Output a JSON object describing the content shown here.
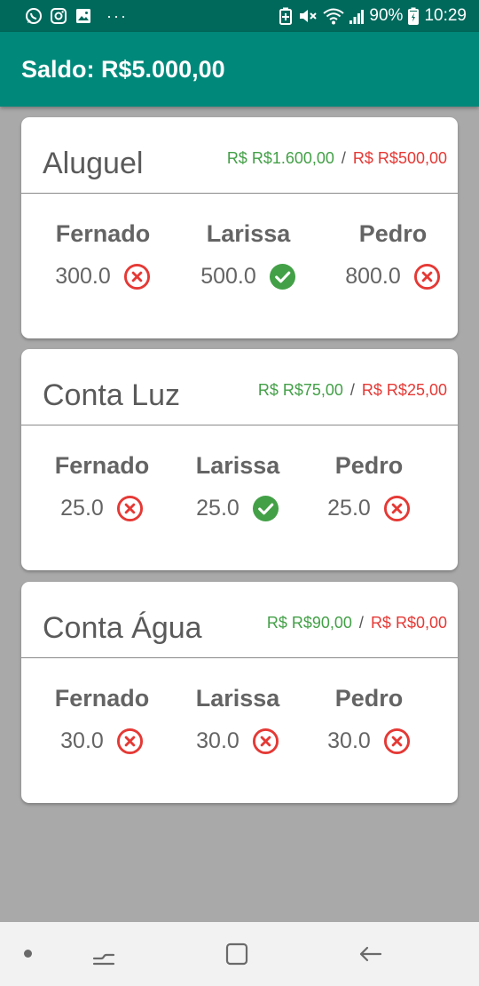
{
  "status_bar": {
    "battery": "90%",
    "time": "10:29",
    "overflow": "···",
    "icons": [
      "whatsapp-icon",
      "instagram-icon",
      "image-icon",
      "battery-saver-icon",
      "mute-icon",
      "wifi-icon",
      "signal-icon",
      "battery-icon"
    ]
  },
  "app_bar": {
    "title": "Saldo: R$5.000,00"
  },
  "colors": {
    "status_bar": "#00695c",
    "app_bar": "#00897b",
    "paid_green": "#43a047",
    "pending_red": "#e53935",
    "background": "#a9a9a9"
  },
  "bills": [
    {
      "title": "Aluguel",
      "total": "R$ R$1.600,00",
      "separator": "/",
      "remaining": "R$ R$500,00",
      "people": [
        {
          "name": "Fernado",
          "value": "300.0",
          "status": "pending"
        },
        {
          "name": "Larissa",
          "value": "500.0",
          "status": "paid"
        },
        {
          "name": "Pedro",
          "value": "800.0",
          "status": "pending"
        }
      ]
    },
    {
      "title": "Conta Luz",
      "total": "R$ R$75,00",
      "separator": "/",
      "remaining": "R$ R$25,00",
      "people": [
        {
          "name": "Fernado",
          "value": "25.0",
          "status": "pending"
        },
        {
          "name": "Larissa",
          "value": "25.0",
          "status": "paid"
        },
        {
          "name": "Pedro",
          "value": "25.0",
          "status": "pending"
        }
      ]
    },
    {
      "title": "Conta Água",
      "total": "R$ R$90,00",
      "separator": "/",
      "remaining": "R$ R$0,00",
      "people": [
        {
          "name": "Fernado",
          "value": "30.0",
          "status": "pending"
        },
        {
          "name": "Larissa",
          "value": "30.0",
          "status": "pending"
        },
        {
          "name": "Pedro",
          "value": "30.0",
          "status": "pending"
        }
      ]
    }
  ],
  "nav_bar": {
    "buttons": [
      "dot-icon",
      "recent-apps-icon",
      "home-icon",
      "back-icon"
    ]
  }
}
